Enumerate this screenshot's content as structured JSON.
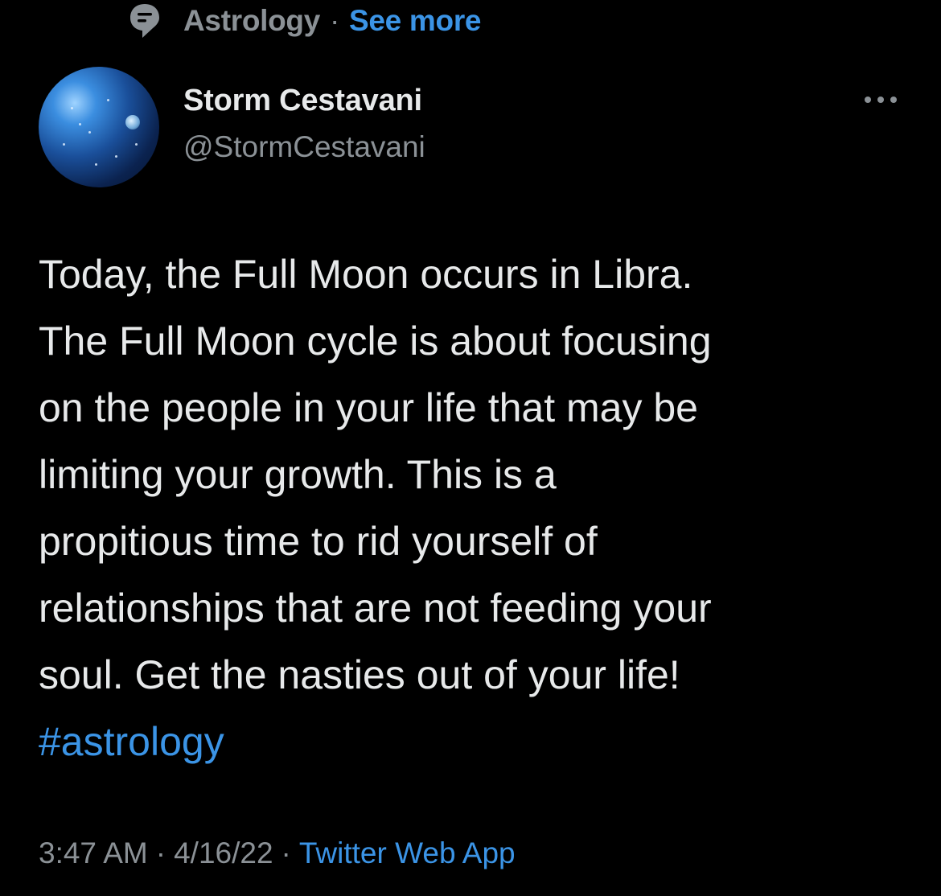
{
  "topic": {
    "icon": "topic-bubble-icon",
    "label": "Astrology",
    "separator": "·",
    "see_more": "See more"
  },
  "author": {
    "avatar": "globe-avatar",
    "display_name": "Storm Cestavani",
    "handle": "@StormCestavani",
    "more_icon": "more-dots-icon"
  },
  "tweet": {
    "lines": [
      "Today, the Full Moon occurs in Libra.",
      "The Full Moon cycle is about focusing",
      "on the people in your life that may be",
      "limiting your growth. This is a",
      "propitious time to rid yourself of",
      "relationships that are not feeding your",
      "soul. Get the nasties out of your life!"
    ],
    "hashtag": "#astrology"
  },
  "meta": {
    "time": "3:47 AM",
    "separator": "·",
    "date": "4/16/22",
    "source": "Twitter Web App"
  },
  "colors": {
    "background": "#000000",
    "text_primary": "#e7e9ea",
    "text_secondary": "#8b9196",
    "accent": "#3b94e6"
  }
}
